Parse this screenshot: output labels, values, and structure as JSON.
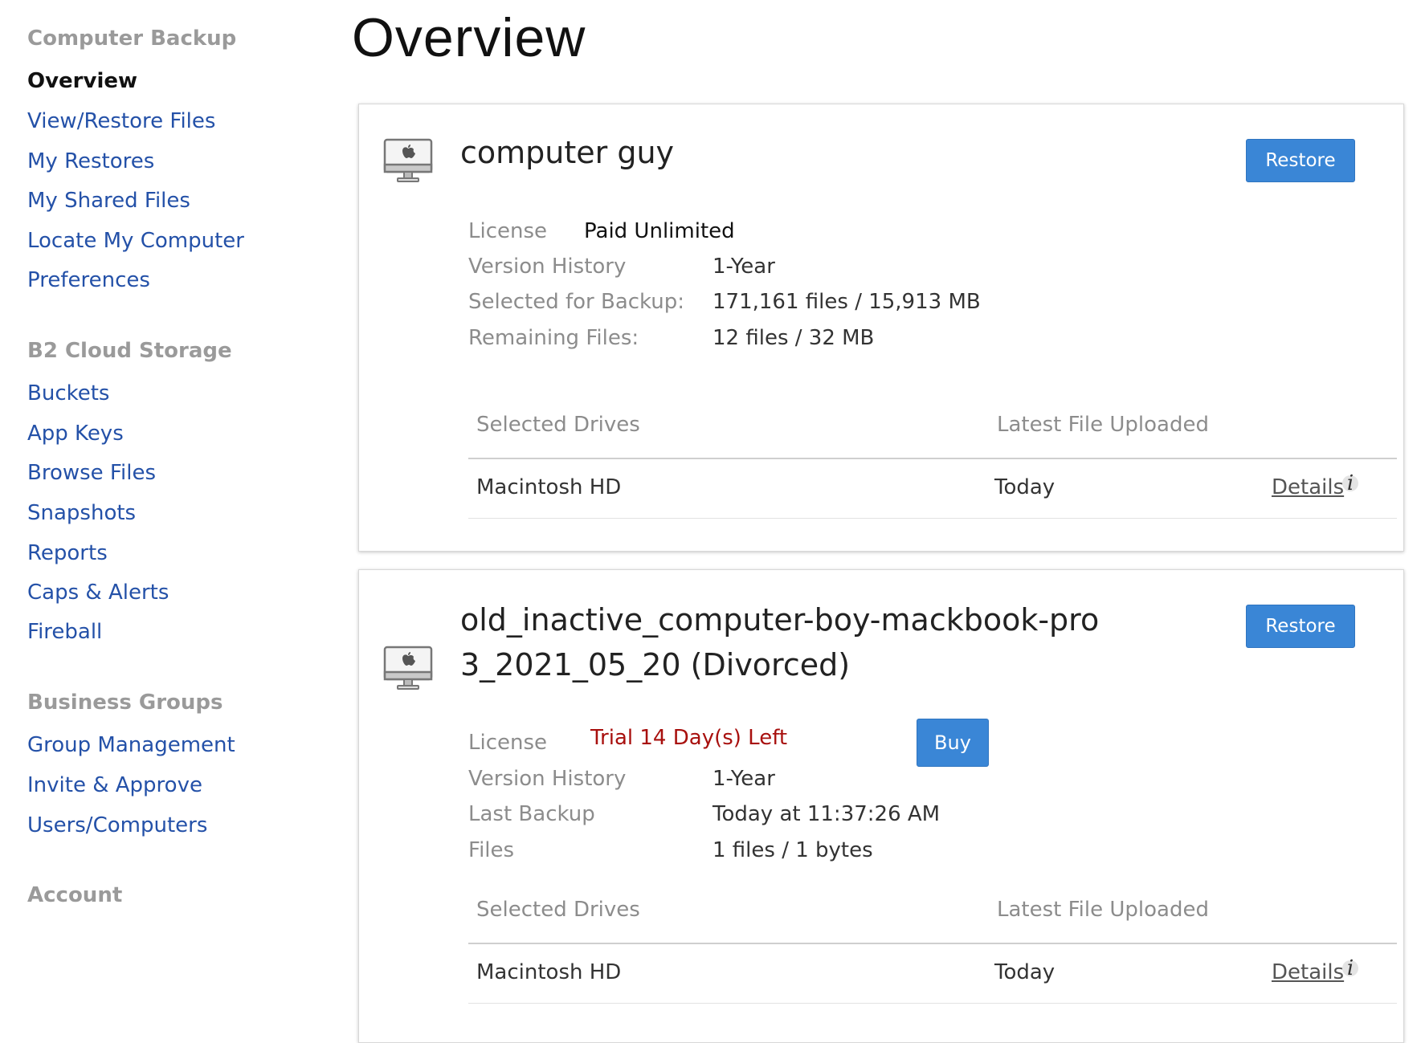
{
  "sidebar": {
    "sections": [
      {
        "heading": "Computer Backup",
        "items": [
          {
            "label": "Overview",
            "active": true
          },
          {
            "label": "View/Restore Files"
          },
          {
            "label": "My Restores"
          },
          {
            "label": "My Shared Files"
          },
          {
            "label": "Locate My Computer"
          },
          {
            "label": "Preferences"
          }
        ]
      },
      {
        "heading": "B2 Cloud Storage",
        "items": [
          {
            "label": "Buckets"
          },
          {
            "label": "App Keys"
          },
          {
            "label": "Browse Files"
          },
          {
            "label": "Snapshots"
          },
          {
            "label": "Reports"
          },
          {
            "label": "Caps & Alerts"
          },
          {
            "label": "Fireball"
          }
        ]
      },
      {
        "heading": "Business Groups",
        "items": [
          {
            "label": "Group Management"
          },
          {
            "label": "Invite & Approve"
          },
          {
            "label": "Users/Computers"
          }
        ]
      },
      {
        "heading": "Account",
        "items": []
      }
    ]
  },
  "main": {
    "title": "Overview",
    "computers": [
      {
        "icon": "mac-computer-icon",
        "name_line1": "computer guy",
        "name_line2": "",
        "restore_label": "Restore",
        "license_label": "License",
        "license_value": "Paid Unlimited",
        "rows": [
          {
            "label": "Version History",
            "value": "1-Year"
          },
          {
            "label": "Selected for Backup:",
            "value": "171,161 files / 15,913 MB"
          },
          {
            "label": "Remaining Files:",
            "value": "12 files / 32 MB"
          }
        ],
        "drives_header": {
          "col1": "Selected Drives",
          "col2": "Latest File Uploaded"
        },
        "drives": [
          {
            "name": "Macintosh HD",
            "latest": "Today",
            "details": "Details"
          }
        ]
      },
      {
        "icon": "mac-computer-icon",
        "name_line1": "old_inactive_computer-boy-mackbook-pro",
        "name_line2": "3_2021_05_20 (Divorced)",
        "restore_label": "Restore",
        "license_label": "License",
        "license_value": "Trial 14 Day(s) Left",
        "buy_label": "Buy",
        "rows": [
          {
            "label": "Version History",
            "value": "1-Year"
          },
          {
            "label": "Last Backup",
            "value": "Today at 11:37:26 AM"
          },
          {
            "label": "Files",
            "value": "1 files / 1 bytes"
          }
        ],
        "drives_header": {
          "col1": "Selected Drives",
          "col2": "Latest File Uploaded"
        },
        "drives": [
          {
            "name": "Macintosh HD",
            "latest": "Today",
            "details": "Details"
          }
        ]
      }
    ]
  },
  "colors": {
    "link": "#2451a8",
    "heading_grey": "#9a9a9a",
    "button_blue": "#3a86d6",
    "trial_red": "#a8100e"
  }
}
